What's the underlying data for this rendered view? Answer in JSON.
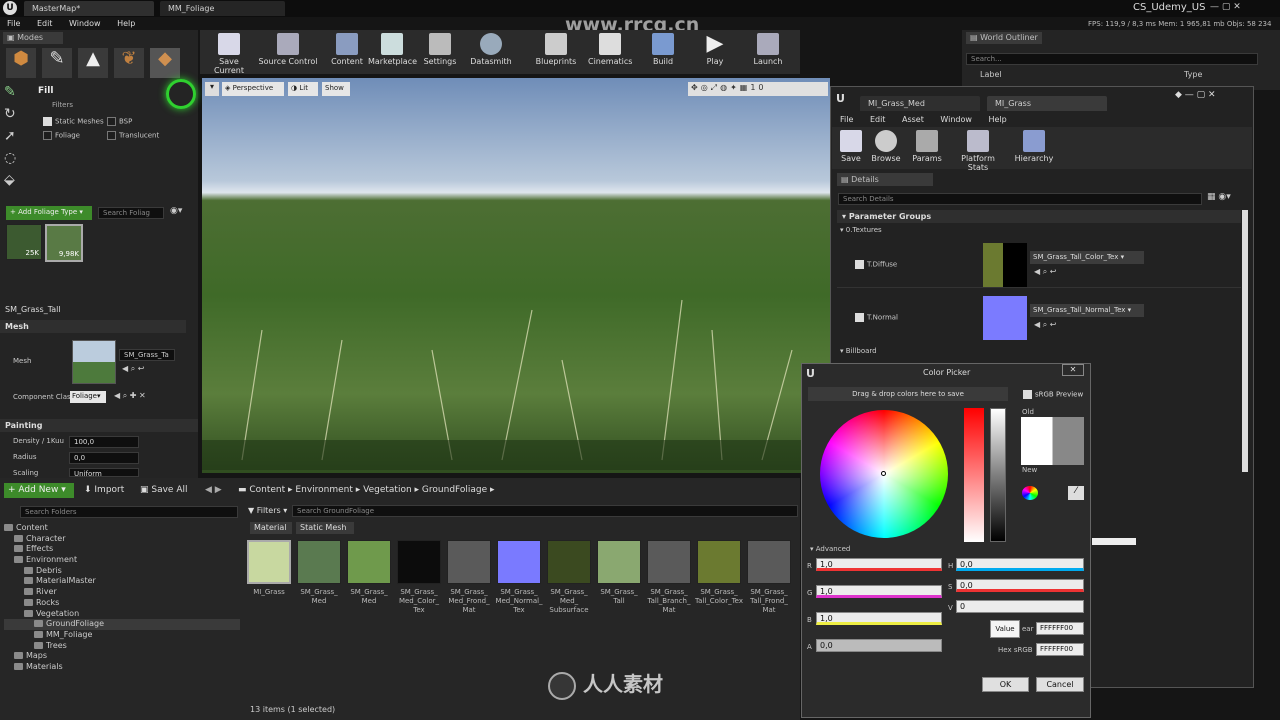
{
  "tabs": [
    "MasterMap*",
    "MM_Foliage"
  ],
  "user": "CS_Udemy_US",
  "watermark_site": "www.rrcg.cn",
  "menu": [
    "File",
    "Edit",
    "Window",
    "Help"
  ],
  "stats": {
    "fps": "FPS: 119,9 / 8,3 ms",
    "mem": "Mem: 1 965,81 mb",
    "objs": "Objs: 58 234"
  },
  "modes": {
    "title": "Modes",
    "fill_label": "Fill",
    "filters_label": "Filters",
    "filters": [
      {
        "label": "Static Meshes",
        "checked": true
      },
      {
        "label": "BSP",
        "checked": false
      },
      {
        "label": "Foliage",
        "checked": false
      },
      {
        "label": "Translucent",
        "checked": false
      }
    ],
    "add_foliage": "Add Foliage Type",
    "search_foliage": "Search Foliag",
    "foliage_counts": [
      "25K",
      "9,98K"
    ],
    "selected_mesh": "SM_Grass_Tall",
    "mesh_section": "Mesh",
    "mesh_label": "Mesh",
    "mesh_value": "SM_Grass_Ta",
    "component_label": "Component Clas",
    "component_value": "Foliage",
    "painting_section": "Painting",
    "density_label": "Density / 1Kuu",
    "density_value": "100,0",
    "radius_label": "Radius",
    "radius_value": "0,0",
    "scaling_label": "Scaling",
    "scaling_value": "Uniform"
  },
  "toolbar": [
    "Save Current",
    "Source Control",
    "Content",
    "Marketplace",
    "Settings",
    "Datasmith",
    "Blueprints",
    "Cinematics",
    "Build",
    "Play",
    "Launch"
  ],
  "viewport": {
    "perspective": "Perspective",
    "lit": "Lit",
    "show": "Show",
    "grid": "10"
  },
  "outliner": {
    "title": "World Outliner",
    "search": "Search...",
    "col_label": "Label",
    "col_type": "Type"
  },
  "content": {
    "add_new": "Add New",
    "import": "Import",
    "save_all": "Save All",
    "breadcrumb": [
      "Content",
      "Environment",
      "Vegetation",
      "GroundFoliage"
    ],
    "search_folders": "Search Folders",
    "filters": "Filters",
    "search_assets": "Search GroundFoliage",
    "filter_chips": [
      "Material",
      "Static Mesh"
    ],
    "status": "13 items (1 selected)",
    "tree": [
      {
        "label": "Content",
        "level": 0
      },
      {
        "label": "Character",
        "level": 1
      },
      {
        "label": "Effects",
        "level": 1
      },
      {
        "label": "Environment",
        "level": 1
      },
      {
        "label": "Debris",
        "level": 2
      },
      {
        "label": "MaterialMaster",
        "level": 2
      },
      {
        "label": "River",
        "level": 2
      },
      {
        "label": "Rocks",
        "level": 2
      },
      {
        "label": "Vegetation",
        "level": 2
      },
      {
        "label": "GroundFoliage",
        "level": 3
      },
      {
        "label": "MM_Foliage",
        "level": 3
      },
      {
        "label": "Trees",
        "level": 3
      },
      {
        "label": "Maps",
        "level": 1
      },
      {
        "label": "Materials",
        "level": 1
      }
    ],
    "assets": [
      {
        "label": "MI_Grass",
        "color": "#c8d8a0"
      },
      {
        "label": "SM_Grass_ Med",
        "color": "#5a7a50"
      },
      {
        "label": "SM_Grass_ Med",
        "color": "#6f9a4c"
      },
      {
        "label": "SM_Grass_ Med_Color_ Tex",
        "color": "#0c0c0c"
      },
      {
        "label": "SM_Grass_ Med_Frond_ Mat",
        "color": "#5a5a5a"
      },
      {
        "label": "SM_Grass_ Med_Normal_ Tex",
        "color": "#7a7aff"
      },
      {
        "label": "SM_Grass_ Med_ Subsurface",
        "color": "#3b4a20"
      },
      {
        "label": "SM_Grass_ Tall",
        "color": "#8aa870"
      },
      {
        "label": "SM_Grass_ Tall_Branch_ Mat",
        "color": "#5a5a5a"
      },
      {
        "label": "SM_Grass_ Tall_Color_Tex",
        "color": "#6b7a30"
      },
      {
        "label": "SM_Grass_ Tall_Frond_ Mat",
        "color": "#5a5a5a"
      }
    ]
  },
  "material_editor": {
    "tabs": [
      "MI_Grass_Med",
      "MI_Grass"
    ],
    "menu": [
      "File",
      "Edit",
      "Asset",
      "Window",
      "Help"
    ],
    "toolbar": [
      "Save",
      "Browse",
      "Params",
      "Platform Stats",
      "Hierarchy"
    ],
    "details_tab": "Details",
    "search": "Search Details",
    "param_groups": "Parameter Groups",
    "textures_group": "0.Textures",
    "params": [
      {
        "label": "T.Diffuse",
        "value": "SM_Grass_Tall_Color_Tex"
      },
      {
        "label": "T.Normal",
        "value": "SM_Grass_Tall_Normal_Tex"
      }
    ],
    "billboard": "Billboard"
  },
  "color_picker": {
    "title": "Color Picker",
    "drag_drop": "Drag & drop colors here to save",
    "srgb_preview": "sRGB Preview",
    "old": "Old",
    "new": "New",
    "advanced": "Advanced",
    "rgba": [
      {
        "label": "R",
        "value": "1,0"
      },
      {
        "label": "G",
        "value": "1,0"
      },
      {
        "label": "B",
        "value": "1,0"
      },
      {
        "label": "A",
        "value": "0,0"
      }
    ],
    "hsv": [
      {
        "label": "H",
        "value": "0,0"
      },
      {
        "label": "S",
        "value": "0,0"
      },
      {
        "label": "V",
        "value": "0"
      }
    ],
    "tooltip": "Value",
    "hex_linear_label": "ear",
    "hex_linear": "FFFFFF00",
    "hex_srgb_label": "Hex sRGB",
    "hex_srgb": "FFFFFF00",
    "ok": "OK",
    "cancel": "Cancel"
  },
  "brand_watermark": "人人素材"
}
